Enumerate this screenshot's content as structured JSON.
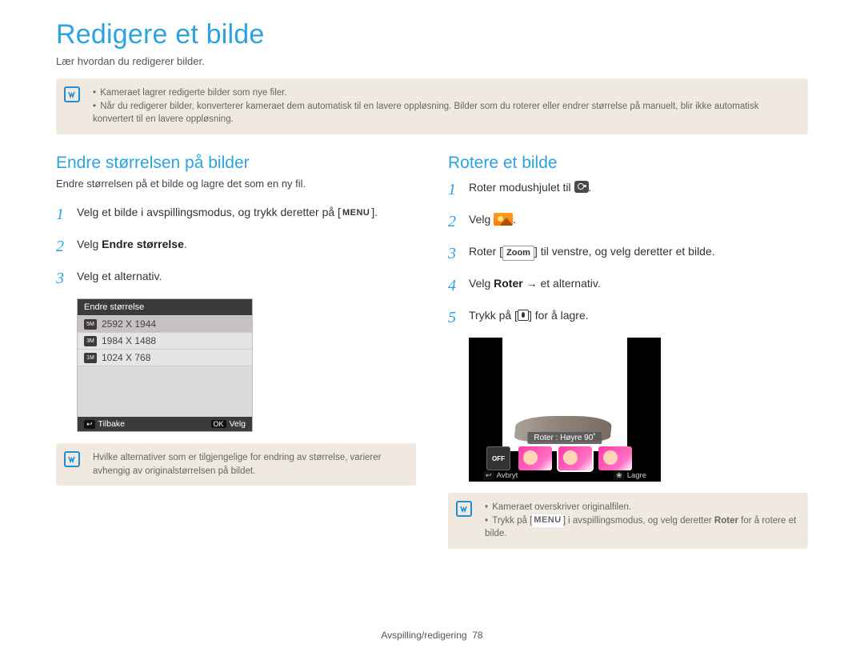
{
  "page_title": "Redigere et bilde",
  "subtitle": "Lær hvordan du redigerer bilder.",
  "top_note": {
    "items": [
      "Kameraet lagrer redigerte bilder som nye filer.",
      "Når du redigerer bilder, konverterer kameraet dem automatisk til en lavere oppløsning. Bilder som du roterer eller endrer størrelse på manuelt, blir ikke automatisk konvertert til en lavere oppløsning."
    ]
  },
  "left": {
    "title": "Endre størrelsen på bilder",
    "desc": "Endre størrelsen på et bilde og lagre det som en ny fil.",
    "steps": {
      "s1_a": "Velg et bilde i avspillingsmodus, og trykk deretter på [",
      "menu_label": "MENU",
      "s1_b": "].",
      "s2_a": "Velg ",
      "s2_b": "Endre størrelse",
      "s2_c": ".",
      "s3": "Velg et alternativ."
    },
    "menu_shot": {
      "header": "Endre størrelse",
      "options": [
        {
          "icon": "5M",
          "label": "2592 X 1944"
        },
        {
          "icon": "3M",
          "label": "1984 X 1488"
        },
        {
          "icon": "1M",
          "label": "1024 X 768"
        }
      ],
      "footer_left_icon": "↩",
      "footer_left": "Tilbake",
      "footer_right_icon": "OK",
      "footer_right": "Velg"
    },
    "note": "Hvilke alternativer som er tilgjengelige for endring av størrelse, varierer avhengig av originalstørrelsen på bildet."
  },
  "right": {
    "title": "Rotere et bilde",
    "steps": {
      "s1_a": "Roter modushjulet til ",
      "s1_b": ".",
      "s2_a": "Velg ",
      "s2_b": ".",
      "s3_a": "Roter [",
      "s3_zoom": "Zoom",
      "s3_b": "] til venstre, og velg deretter et bilde.",
      "s4_a": "Velg ",
      "s4_b": "Roter",
      "s4_c": " → et alternativ.",
      "s5_a": "Trykk på [",
      "s5_b": "] for å lagre."
    },
    "rotate_shot": {
      "label": "Roter : Høyre 90˚",
      "off": "OFF",
      "footer_left_icon": "↩",
      "footer_left": "Avbryt",
      "footer_right_icon": "❀",
      "footer_right": "Lagre"
    },
    "note": {
      "item1": "Kameraet overskriver originalfilen.",
      "item2_a": "Trykk på [",
      "item2_menu": "MENU",
      "item2_b": "] i avspillingsmodus, og velg deretter ",
      "item2_c": "Roter",
      "item2_d": " for å rotere et bilde."
    }
  },
  "footer": {
    "section": "Avspilling/redigering",
    "page": "78"
  }
}
